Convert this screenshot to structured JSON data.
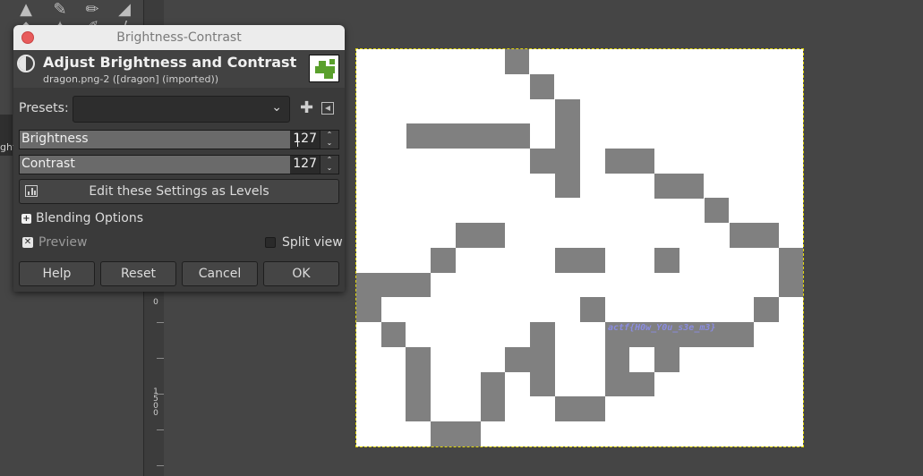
{
  "dialog": {
    "window_title": "Brightness-Contrast",
    "header_title": "Adjust Brightness and Contrast",
    "header_subtitle": "dragon.png-2 ([dragon] (imported))",
    "presets_label": "Presets:",
    "presets_value": "",
    "add_preset_symbol": "✚",
    "brightness": {
      "label": "Brightness",
      "value": "127",
      "level": 0.9
    },
    "contrast": {
      "label": "Contrast",
      "value": "127",
      "level": 0.9
    },
    "levels_button": "Edit these Settings as Levels",
    "blending_label": "Blending Options",
    "preview_label": "Preview",
    "preview_checked": true,
    "split_view_label": "Split view",
    "split_view_checked": false,
    "buttons": {
      "help": "Help",
      "reset": "Reset",
      "cancel": "Cancel",
      "ok": "OK"
    }
  },
  "toolbox": {
    "partial_label": "ght"
  },
  "ruler": {
    "num_a": "0",
    "num_b": "1",
    "num_c": "5",
    "num_d": "0",
    "num_e": "0"
  },
  "canvas": {
    "hidden_text": "actf{H0w_Y0u_s3e_m3}"
  },
  "colors": {
    "dialog_bg": "#3a3a3a",
    "pixel_gray": "#808080",
    "titlebar": "#ececec",
    "close": "#e85c5c"
  }
}
